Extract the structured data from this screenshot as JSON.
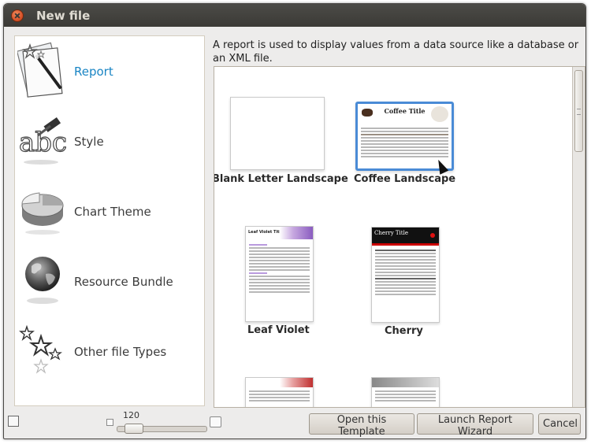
{
  "window": {
    "title": "New file"
  },
  "categories": [
    {
      "label": "Report",
      "icon": "report-icon",
      "selected": true
    },
    {
      "label": "Style",
      "icon": "style-icon"
    },
    {
      "label": "Chart Theme",
      "icon": "chart-theme-icon"
    },
    {
      "label": "Resource Bundle",
      "icon": "globe-icon"
    },
    {
      "label": "Other file Types",
      "icon": "stars-icon"
    }
  ],
  "description": "A report is used to display values from a data source like a database or an XML file.",
  "templates": [
    {
      "label": "Blank Letter Landscape"
    },
    {
      "label": "Coffee Landscape",
      "selected": true,
      "thumb_title": "Coffee Title"
    },
    {
      "label": "Leaf Violet",
      "thumb_title": "Leaf Violet Title"
    },
    {
      "label": "Cherry",
      "thumb_title": "Cherry Title"
    }
  ],
  "zoom": {
    "label": "120"
  },
  "buttons": {
    "open_template": "Open this Template",
    "launch_wizard": "Launch Report Wizard",
    "cancel": "Cancel"
  },
  "colors": {
    "accent": "#1a85c4",
    "selection": "#4a8bd6",
    "titlebar": "#3c3b37"
  }
}
